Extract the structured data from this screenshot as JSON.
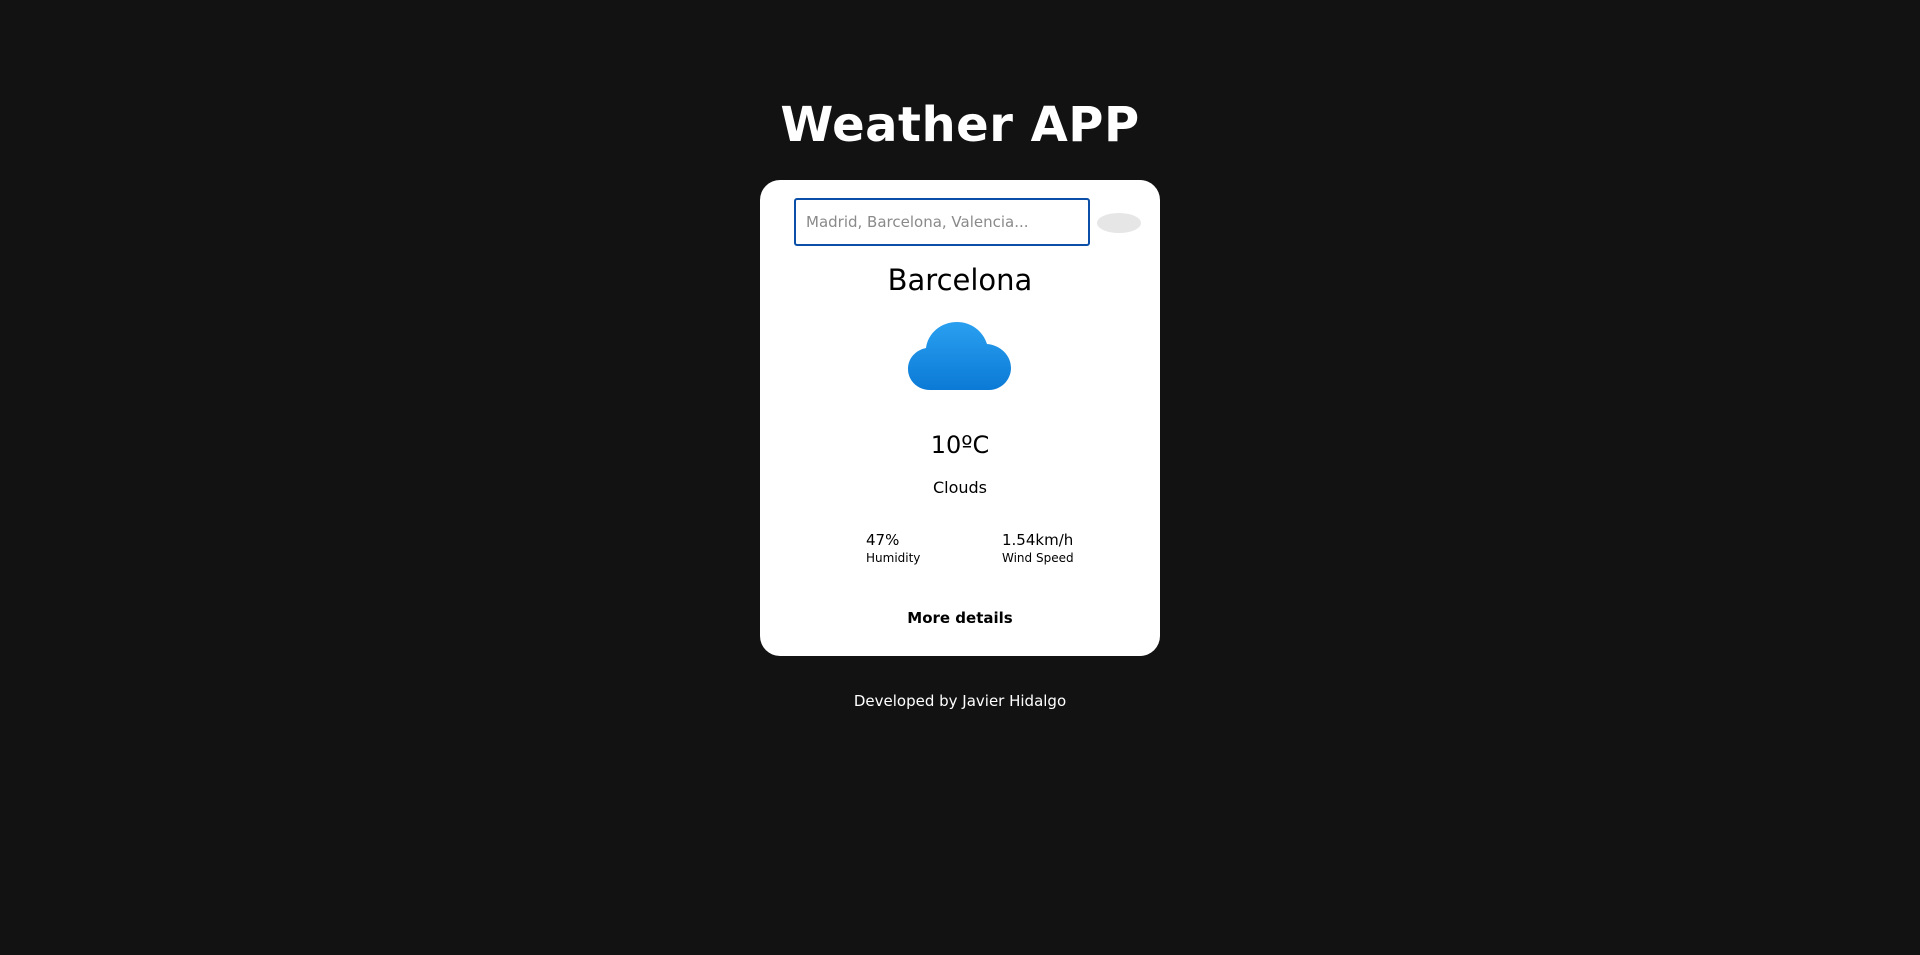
{
  "header": {
    "title": "Weather APP"
  },
  "search": {
    "placeholder": "Madrid, Barcelona, Valencia...",
    "value": ""
  },
  "weather": {
    "city": "Barcelona",
    "icon": "cloud-icon",
    "temperature": "10ºC",
    "condition": "Clouds",
    "humidity_value": "47%",
    "humidity_label": "Humidity",
    "wind_value": "1.54km/h",
    "wind_label": "Wind Speed",
    "more_details_label": "More details"
  },
  "footer": {
    "text": "Developed by Javier Hidalgo"
  },
  "colors": {
    "background": "#121212",
    "card": "#ffffff",
    "input_border": "#0b4fa8",
    "cloud": "#1a8fe8"
  }
}
